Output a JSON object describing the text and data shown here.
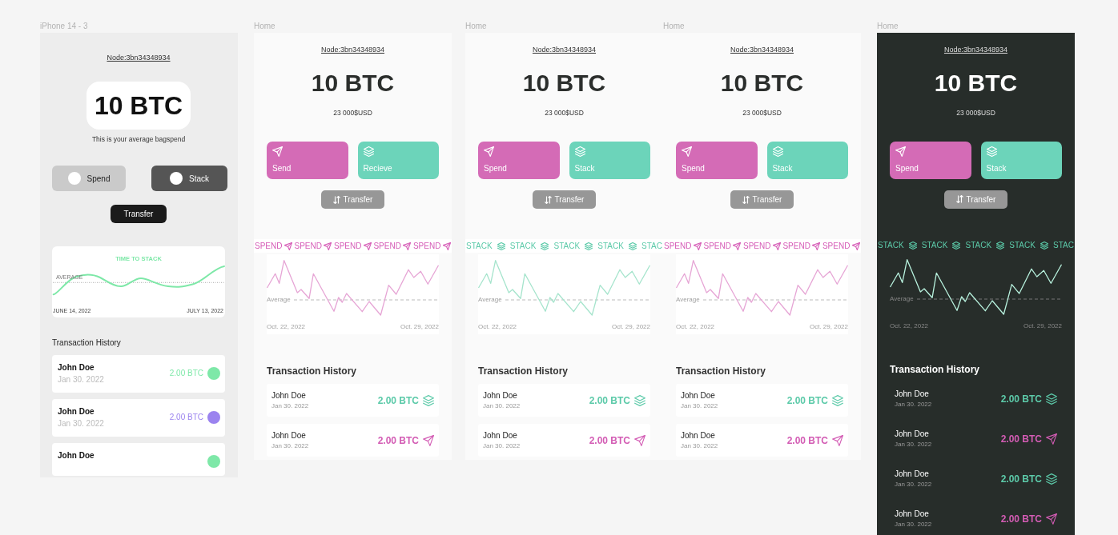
{
  "canvas": {
    "frames": [
      {
        "kind": "draft",
        "label": "iPhone 14 - 3",
        "node": "Node:3bn34348934",
        "balance": "10 BTC",
        "caption": "This is your average bagspend",
        "toggles": [
          {
            "label": "Spend",
            "selected": false
          },
          {
            "label": "Stack",
            "selected": true
          }
        ],
        "transfer": "Transfer",
        "chart": {
          "title": "TIME TO STACK",
          "average": "AVERAGE",
          "start": "JUNE 14, 2022",
          "end": "JULY 13, 2022"
        },
        "history_title": "Transaction History",
        "transactions": [
          {
            "name": "John Doe",
            "date": "Jan 30. 2022",
            "amount": "2.00 BTC",
            "color": "#7ee8a8"
          },
          {
            "name": "John Doe",
            "date": "Jan 30. 2022",
            "amount": "2.00 BTC",
            "color": "#9b83ef"
          },
          {
            "name": "John Doe",
            "color": "#7ee8a8"
          }
        ]
      },
      {
        "kind": "light",
        "label": "Home",
        "node": "Node:3bn34348934",
        "balance": "10 BTC",
        "fiat": "23 000$USD",
        "actions": [
          {
            "label": "Send",
            "kind": "send"
          },
          {
            "label": "Recieve",
            "kind": "stack"
          }
        ],
        "transfer": "Transfer",
        "ticker": {
          "kind": "send",
          "items": [
            {
              "text": "SPEND",
              "icon": true
            },
            {
              "text": "SPEND",
              "icon": true
            },
            {
              "text": "SPEND",
              "icon": true
            },
            {
              "text": "SPEND",
              "icon": true
            },
            {
              "text": "SPEND",
              "icon": true
            }
          ]
        },
        "chart": {
          "kind": "send",
          "average": "Average",
          "start": "Oct. 22, 2022",
          "end": "Oct. 29, 2022"
        },
        "history_title": "Transaction History",
        "transactions": [
          {
            "name": "John Doe",
            "date": "Jan 30. 2022",
            "amount": "2.00 BTC",
            "kind": "stack"
          },
          {
            "name": "John Doe",
            "date": "Jan 30. 2022",
            "amount": "2.00 BTC",
            "kind": "send"
          }
        ]
      },
      {
        "kind": "light",
        "label": "Home",
        "node": "Node:3bn34348934",
        "balance": "10 BTC",
        "fiat": "23 000$USD",
        "actions": [
          {
            "label": "Spend",
            "kind": "send"
          },
          {
            "label": "Stack",
            "kind": "stack"
          }
        ],
        "transfer": "Transfer",
        "ticker": {
          "kind": "stack",
          "items": [
            {
              "text": "STACK",
              "icon": true
            },
            {
              "text": "STACK",
              "icon": true
            },
            {
              "text": "STACK",
              "icon": true
            },
            {
              "text": "STACK",
              "icon": true
            },
            {
              "text": "STAC",
              "icon": false
            }
          ]
        },
        "chart": {
          "kind": "stack",
          "average": "Average",
          "start": "Oct. 22, 2022",
          "end": "Oct. 29, 2022"
        },
        "history_title": "Transaction History",
        "transactions": [
          {
            "name": "John Doe",
            "date": "Jan 30. 2022",
            "amount": "2.00 BTC",
            "kind": "stack"
          },
          {
            "name": "John Doe",
            "date": "Jan 30. 2022",
            "amount": "2.00 BTC",
            "kind": "send"
          }
        ]
      },
      {
        "kind": "light",
        "label": "Home",
        "node": "Node:3bn34348934",
        "balance": "10 BTC",
        "fiat": "23 000$USD",
        "actions": [
          {
            "label": "Spend",
            "kind": "send"
          },
          {
            "label": "Stack",
            "kind": "stack"
          }
        ],
        "transfer": "Transfer",
        "ticker": {
          "kind": "send",
          "items": [
            {
              "text": "SPEND",
              "icon": true
            },
            {
              "text": "SPEND",
              "icon": true
            },
            {
              "text": "SPEND",
              "icon": true
            },
            {
              "text": "SPEND",
              "icon": true
            },
            {
              "text": "SPEND",
              "icon": true
            }
          ]
        },
        "chart": {
          "kind": "send",
          "average": "Average",
          "start": "Oct. 22, 2022",
          "end": "Oct. 29, 2022"
        },
        "history_title": "Transaction History",
        "transactions": [
          {
            "name": "John Doe",
            "date": "Jan 30. 2022",
            "amount": "2.00 BTC",
            "kind": "stack"
          },
          {
            "name": "John Doe",
            "date": "Jan 30. 2022",
            "amount": "2.00 BTC",
            "kind": "send"
          }
        ]
      },
      {
        "kind": "dark",
        "label": "Home",
        "node": "Node:3bn34348934",
        "balance": "10 BTC",
        "fiat": "23 000$USD",
        "actions": [
          {
            "label": "Spend",
            "kind": "send"
          },
          {
            "label": "Stack",
            "kind": "stack"
          }
        ],
        "transfer": "Transfer",
        "ticker": {
          "kind": "stack",
          "items": [
            {
              "text": "STACK",
              "icon": true
            },
            {
              "text": "STACK",
              "icon": true
            },
            {
              "text": "STACK",
              "icon": true
            },
            {
              "text": "STACK",
              "icon": true
            },
            {
              "text": "STAC",
              "icon": false
            }
          ]
        },
        "chart": {
          "kind": "stack",
          "average": "Average",
          "start": "Oct. 22, 2022",
          "end": "Oct. 29, 2022"
        },
        "history_title": "Transaction History",
        "transactions": [
          {
            "name": "John Doe",
            "date": "Jan 30. 2022",
            "amount": "2.00 BTC",
            "kind": "stack"
          },
          {
            "name": "John Doe",
            "date": "Jan 30. 2022",
            "amount": "2.00 BTC",
            "kind": "send"
          },
          {
            "name": "John Doe",
            "date": "Jan 30. 2022",
            "amount": "2.00 BTC",
            "kind": "stack"
          },
          {
            "name": "John Doe",
            "date": "Jan 30. 2022",
            "amount": "2.00 BTC",
            "kind": "send"
          }
        ]
      }
    ]
  }
}
